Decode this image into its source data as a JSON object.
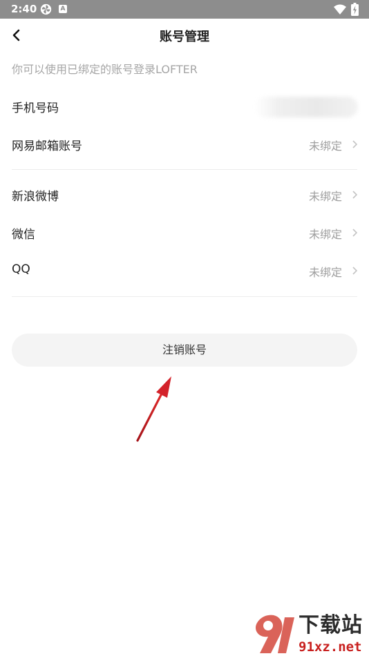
{
  "status_bar": {
    "time": "2:40",
    "icons": [
      "pinwheel-icon",
      "a-badge-icon",
      "wifi-icon",
      "battery-charging-icon"
    ],
    "badge_letter": "A"
  },
  "header": {
    "title": "账号管理",
    "back_icon": "chevron-left-icon"
  },
  "hint": "你可以使用已绑定的账号登录LOFTER",
  "accounts": [
    {
      "label": "手机号码",
      "value": ""
    },
    {
      "label": "网易邮箱账号",
      "value": "未绑定"
    },
    {
      "label": "新浪微博",
      "value": "未绑定"
    },
    {
      "label": "微信",
      "value": "未绑定"
    },
    {
      "label": "QQ",
      "value": "未绑定"
    }
  ],
  "cancel_account_label": "注销账号",
  "annotation": {
    "color": "#c8201f"
  },
  "watermark": {
    "title": "下载站",
    "domain": "91xz.net"
  },
  "colors": {
    "status_bar": "#8d8d8d",
    "button_bg": "#f4f4f4",
    "muted_text": "#9e9e9e",
    "watermark_red": "#c8201f"
  }
}
